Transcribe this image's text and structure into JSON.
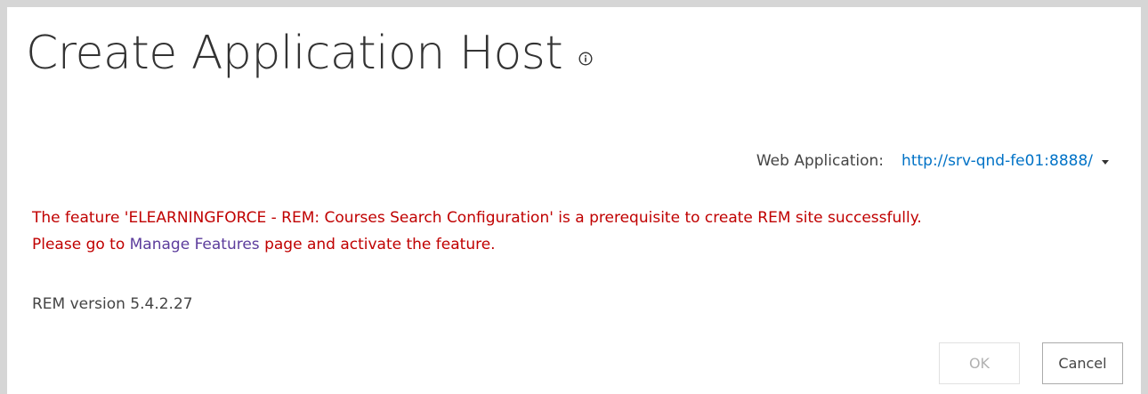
{
  "page": {
    "title": "Create Application Host"
  },
  "web_application": {
    "label": "Web Application:",
    "value": "http://srv-qnd-fe01:8888/"
  },
  "error": {
    "line1": "The feature 'ELEARNINGFORCE - REM: Courses Search Configuration' is a prerequisite to create REM site successfully.",
    "line2_prefix": "Please go to ",
    "line2_link": "Manage Features",
    "line2_suffix": " page and activate the feature."
  },
  "version": {
    "text": "REM version 5.4.2.27"
  },
  "buttons": {
    "ok_label": "OK",
    "ok_disabled": true,
    "cancel_label": "Cancel"
  },
  "colors": {
    "error": "#c00000",
    "link": "#0072c6",
    "visited_link": "#5c3c9c",
    "frame_border": "#d6d6d6"
  }
}
